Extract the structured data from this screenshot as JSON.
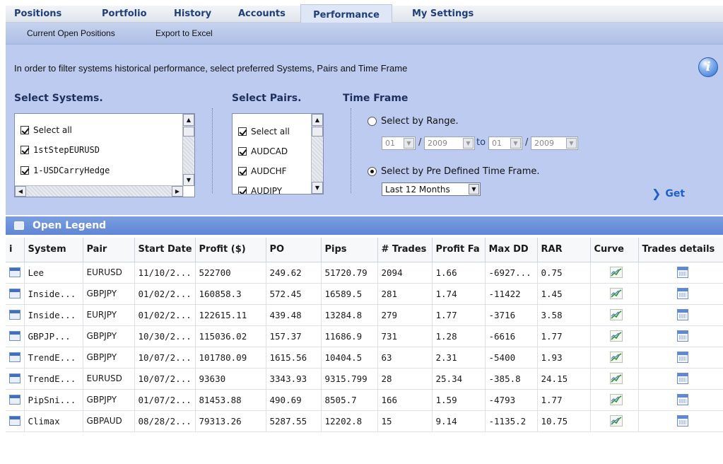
{
  "tabs": [
    "Positions",
    "Portfolio",
    "History",
    "Accounts",
    "Performance",
    "My Settings"
  ],
  "active_tab": "Performance",
  "subnav": [
    "Current Open Positions",
    "Export to Excel"
  ],
  "filter": {
    "intro": "In order to filter systems historical performance, select preferred Systems, Pairs and Time Frame",
    "systems_title": "Select Systems.",
    "systems": [
      "Select all",
      "1stStepEURUSD",
      "1-USDCarryHedge"
    ],
    "pairs_title": "Select Pairs.",
    "pairs": [
      "Select all",
      "AUDCAD",
      "AUDCHF",
      "AUDJPY"
    ],
    "timeframe_title": "Time Frame",
    "range_label": "Select by Range.",
    "range_from_month": "01",
    "range_from_year": "2009",
    "range_to_label": "to",
    "range_to_month": "01",
    "range_to_year": "2009",
    "predefined_label": "Select by Pre Defined Time Frame.",
    "predefined_value": "Last 12 Months",
    "get_label": "Get"
  },
  "legend_label": "Open Legend",
  "table": {
    "headers": [
      "i",
      "System",
      "Pair",
      "Start Date",
      "Profit ($)",
      "PO",
      "Pips",
      "# Trades",
      "Profit Fa",
      "Max DD",
      "RAR",
      "Curve",
      "Trades details"
    ],
    "rows": [
      [
        "Lee",
        "EURUSD",
        "11/10/2...",
        "522700",
        "249.62",
        "51720.79",
        "2094",
        "1.66",
        "-6927...",
        "0.75"
      ],
      [
        "Inside...",
        "GBPJPY",
        "01/02/2...",
        "160858.3",
        "572.45",
        "16589.5",
        "281",
        "1.74",
        "-11422",
        "1.45"
      ],
      [
        "Inside...",
        "EURJPY",
        "01/02/2...",
        "122615.11",
        "439.48",
        "13284.8",
        "279",
        "1.77",
        "-3716",
        "3.58"
      ],
      [
        "GBPJP...",
        "GBPJPY",
        "10/30/2...",
        "115036.02",
        "157.37",
        "11686.9",
        "731",
        "1.28",
        "-6616",
        "1.77"
      ],
      [
        "TrendE...",
        "GBPJPY",
        "10/07/2...",
        "101780.09",
        "1615.56",
        "10404.5",
        "63",
        "2.31",
        "-5400",
        "1.93"
      ],
      [
        "TrendE...",
        "EURUSD",
        "10/07/2...",
        "93630",
        "3343.93",
        "9315.799",
        "28",
        "25.34",
        "-385.8",
        "24.15"
      ],
      [
        "PipSni...",
        "GBPJPY",
        "01/07/2...",
        "81453.88",
        "490.69",
        "8505.7",
        "166",
        "1.59",
        "-4793",
        "1.77"
      ],
      [
        "Climax",
        "GBPAUD",
        "08/28/2...",
        "79313.26",
        "5287.55",
        "12202.8",
        "15",
        "9.14",
        "-1135.2",
        "10.75"
      ]
    ]
  },
  "colors": {
    "panel": "#bccbef",
    "legend": "#6a8fdb",
    "tab_text": "#1f3f7a",
    "get": "#1f5fc6"
  }
}
